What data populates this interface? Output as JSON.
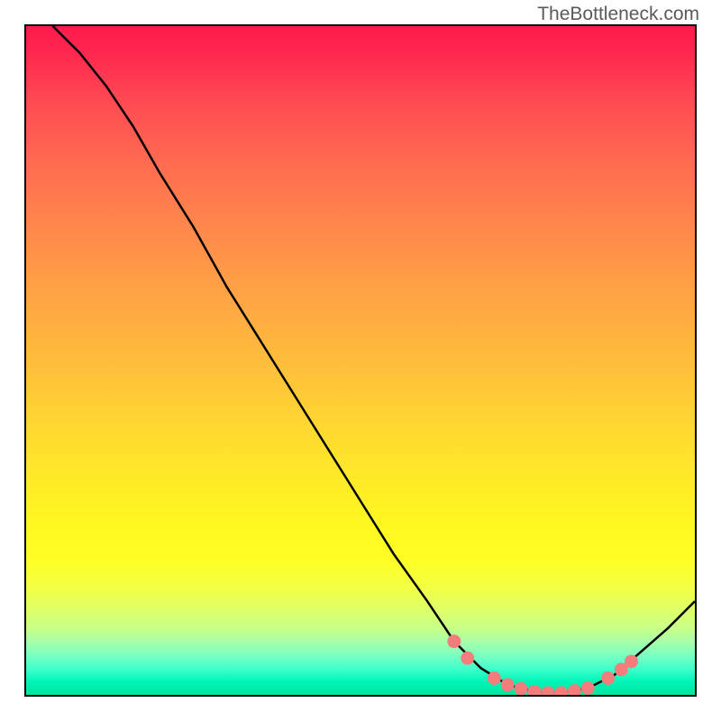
{
  "attribution": "TheBottleneck.com",
  "chart_data": {
    "type": "line",
    "title": "",
    "xlabel": "",
    "ylabel": "",
    "xlim": [
      0,
      100
    ],
    "ylim": [
      0,
      100
    ],
    "curve_points": [
      {
        "x": 4,
        "y": 100
      },
      {
        "x": 8,
        "y": 96
      },
      {
        "x": 12,
        "y": 91
      },
      {
        "x": 16,
        "y": 85
      },
      {
        "x": 20,
        "y": 78
      },
      {
        "x": 25,
        "y": 70
      },
      {
        "x": 30,
        "y": 61
      },
      {
        "x": 35,
        "y": 53
      },
      {
        "x": 40,
        "y": 45
      },
      {
        "x": 45,
        "y": 37
      },
      {
        "x": 50,
        "y": 29
      },
      {
        "x": 55,
        "y": 21
      },
      {
        "x": 60,
        "y": 14
      },
      {
        "x": 64,
        "y": 8
      },
      {
        "x": 68,
        "y": 4
      },
      {
        "x": 72,
        "y": 1.5
      },
      {
        "x": 76,
        "y": 0.5
      },
      {
        "x": 80,
        "y": 0.3
      },
      {
        "x": 84,
        "y": 1
      },
      {
        "x": 88,
        "y": 3
      },
      {
        "x": 92,
        "y": 6.5
      },
      {
        "x": 96,
        "y": 10
      },
      {
        "x": 100,
        "y": 14
      }
    ],
    "marker_points": [
      {
        "x": 64,
        "y": 8
      },
      {
        "x": 66,
        "y": 5.5
      },
      {
        "x": 70,
        "y": 2.5
      },
      {
        "x": 72,
        "y": 1.5
      },
      {
        "x": 74,
        "y": 0.9
      },
      {
        "x": 76,
        "y": 0.5
      },
      {
        "x": 78,
        "y": 0.3
      },
      {
        "x": 80,
        "y": 0.3
      },
      {
        "x": 82,
        "y": 0.6
      },
      {
        "x": 84,
        "y": 1
      },
      {
        "x": 87,
        "y": 2.5
      },
      {
        "x": 89,
        "y": 3.8
      },
      {
        "x": 90.5,
        "y": 5
      }
    ],
    "marker_color": "#f47c7c",
    "line_color": "#000000",
    "gradient_note": "red-to-green vertical gradient background"
  }
}
